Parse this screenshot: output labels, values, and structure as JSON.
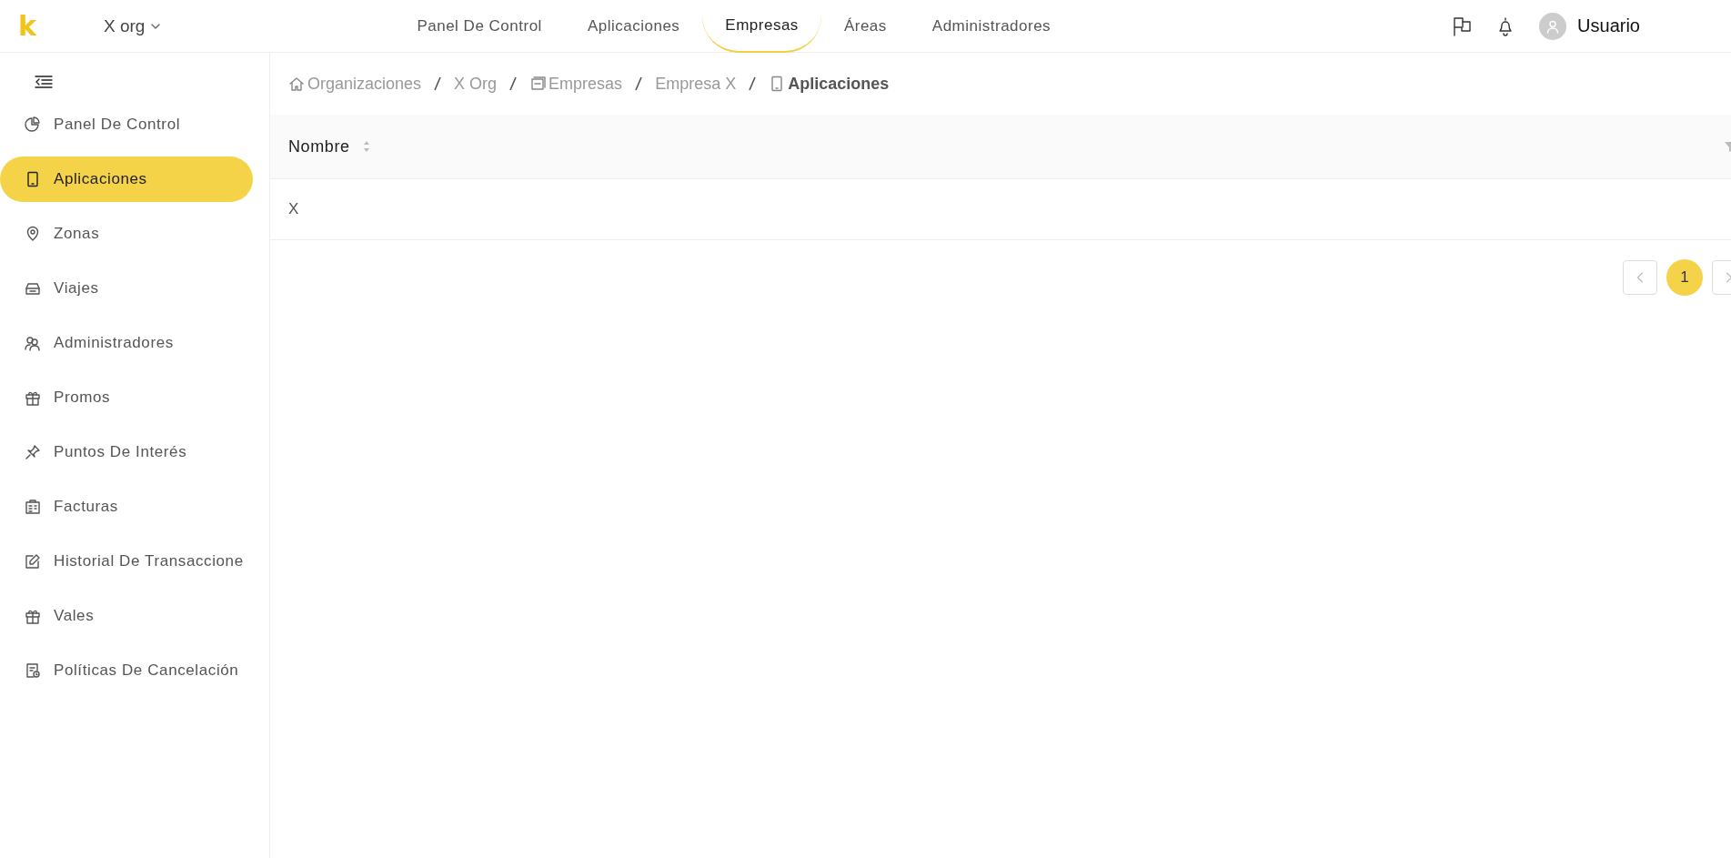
{
  "header": {
    "logo": "k",
    "org_switcher": "X org",
    "nav": [
      {
        "label": "Panel De Control",
        "selected": false
      },
      {
        "label": "Aplicaciones",
        "selected": false
      },
      {
        "label": "Empresas",
        "selected": true
      },
      {
        "label": "Áreas",
        "selected": false
      },
      {
        "label": "Administradores",
        "selected": false
      }
    ],
    "user": "Usuario"
  },
  "sidebar": {
    "items": [
      {
        "label": "Panel De Control",
        "selected": false
      },
      {
        "label": "Aplicaciones",
        "selected": true
      },
      {
        "label": "Zonas",
        "selected": false
      },
      {
        "label": "Viajes",
        "selected": false
      },
      {
        "label": "Administradores",
        "selected": false
      },
      {
        "label": "Promos",
        "selected": false
      },
      {
        "label": "Puntos De Interés",
        "selected": false
      },
      {
        "label": "Facturas",
        "selected": false
      },
      {
        "label": "Historial De Transaccione",
        "selected": false
      },
      {
        "label": "Vales",
        "selected": false
      },
      {
        "label": "Políticas De Cancelación",
        "selected": false
      }
    ]
  },
  "breadcrumb": [
    {
      "label": "Organizaciones",
      "kind": "home"
    },
    {
      "label": "X Org",
      "kind": "plain"
    },
    {
      "label": "Empresas",
      "kind": "company"
    },
    {
      "label": "Empresa X",
      "kind": "plain"
    },
    {
      "label": "Aplicaciones",
      "kind": "app"
    }
  ],
  "table": {
    "columns": [
      "Nombre"
    ],
    "rows": [
      [
        "X"
      ]
    ]
  },
  "pagination": {
    "pages": [
      {
        "label": "1",
        "selected": true
      }
    ]
  }
}
